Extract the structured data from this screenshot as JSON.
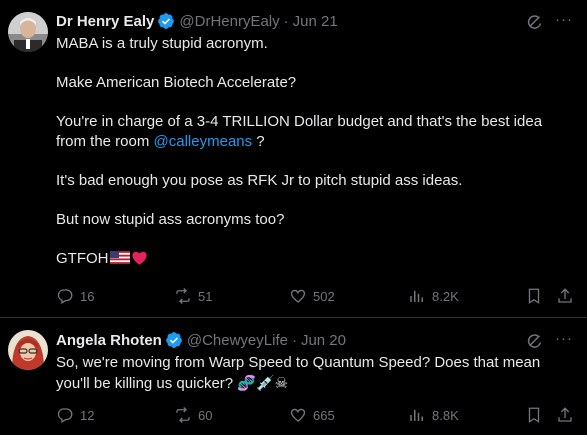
{
  "tweets": [
    {
      "name": "Dr Henry Ealy",
      "handle": "@DrHenryEaly",
      "separator": "·",
      "date": "Jun 21",
      "paragraphs": {
        "p1": "MABA is a truly stupid acronym.",
        "p2": "Make American Biotech Accelerate?",
        "p3a": "You're in charge of a 3-4 TRILLION Dollar budget and that's the best idea from the room ",
        "p3link": "@calleymeans",
        "p3b": " ?",
        "p4": "It's bad enough you pose as RFK Jr to pitch stupid ass ideas.",
        "p5": "But now stupid ass acronyms too?",
        "p6": "GTFOH"
      },
      "emoji_trail": "🇺🇸❤",
      "stats": {
        "replies": "16",
        "reposts": "51",
        "likes": "502",
        "views": "8.2K"
      }
    },
    {
      "name": "Angela Rhoten",
      "handle": "@ChewyeyLife",
      "separator": "·",
      "date": "Jun 20",
      "text": "So, we're moving from Warp Speed to Quantum Speed? Does that mean you'll be killing us quicker?",
      "emoji_trail": "🧬💉☠",
      "stats": {
        "replies": "12",
        "reposts": "60",
        "likes": "665",
        "views": "8.8K"
      }
    }
  ],
  "icons": {
    "verified": "verified-badge-icon",
    "grok": "grok-icon",
    "more": "more-icon",
    "more_glyph": "···",
    "reply": "reply-icon",
    "repost": "repost-icon",
    "like": "like-icon",
    "views": "views-icon",
    "bookmark": "bookmark-icon",
    "share": "share-icon"
  },
  "colors": {
    "background": "#000000",
    "text": "#e7e9ea",
    "secondary": "#71767b",
    "link": "#1d9bf0",
    "verified": "#1d9bf0",
    "divider": "#2f3336"
  }
}
